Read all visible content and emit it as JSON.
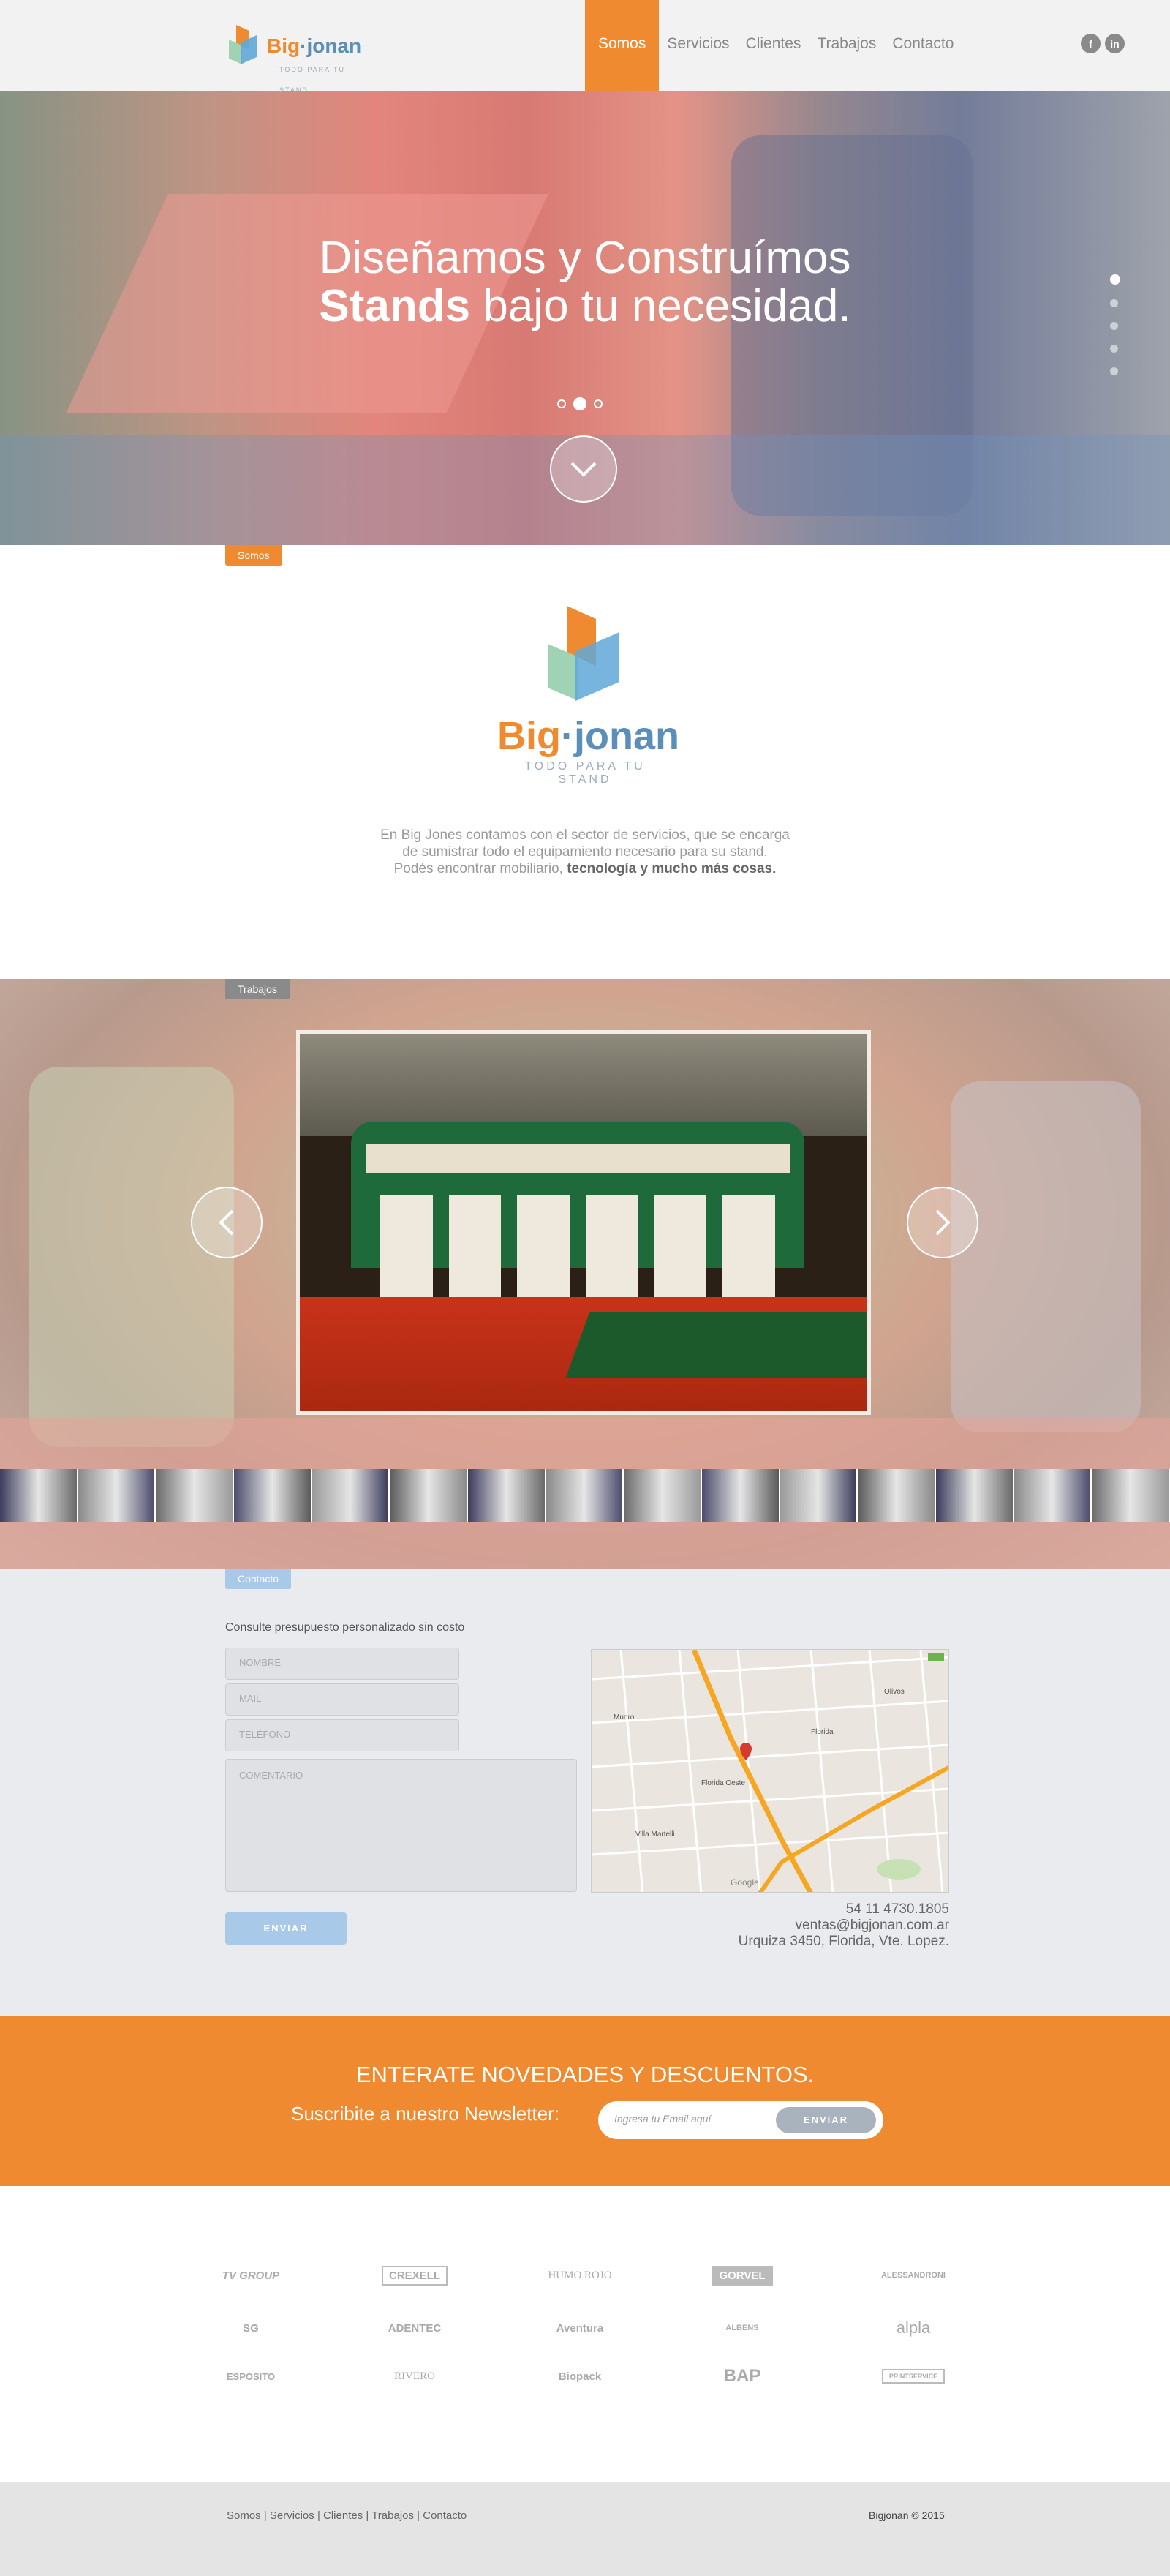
{
  "header": {
    "logo": {
      "brand_left": "Big",
      "brand_dot": "·",
      "brand_right": "jonan",
      "tagline": "TODO PARA TU STAND"
    },
    "nav": [
      "Somos",
      "Servicios",
      "Clientes",
      "Trabajos",
      "Contacto"
    ],
    "active_nav": "Somos",
    "social": [
      "facebook-icon",
      "linkedin-icon"
    ]
  },
  "hero": {
    "line1": "Diseñamos y Construímos",
    "line2_bold": "Stands",
    "line2_rest": " bajo tu necesidad.",
    "slide_dots": 3,
    "active_slide": 2,
    "section_dots": 5,
    "active_section": 1
  },
  "somos": {
    "tag": "Somos",
    "logo_brand_left": "Big",
    "logo_brand_dot": "·",
    "logo_brand_right": "jonan",
    "logo_tagline": "TODO PARA TU STAND",
    "text_line1": "En Big Jones contamos con el sector de servicios, que se encarga",
    "text_line2": "de sumistrar todo el equipamiento necesario para su stand.",
    "text_line3_plain": "Podés encontrar mobiliario, ",
    "text_line3_bold": "tecnología y mucho más cosas."
  },
  "trabajos": {
    "tag": "Trabajos",
    "thumb_count": 15
  },
  "contacto": {
    "tag": "Contacto",
    "title": "Consulte presupuesto personalizado sin costo",
    "fields": {
      "nombre": "NOMBRE",
      "mail": "MAIL",
      "telefono": "TELÉFONO",
      "comentario": "COMENTARIO"
    },
    "send_label": "ENVIAR",
    "phone": "54 11 4730.1805",
    "email": "ventas@bigjonan.com.ar",
    "address": "Urquiza 3450, Florida, Vte. Lopez.",
    "map_labels": [
      "Munro",
      "Florida",
      "Florida Oeste",
      "Villa Martelli",
      "Olivos",
      "Google"
    ]
  },
  "newsletter": {
    "title": "ENTERATE NOVEDADES Y DESCUENTOS.",
    "subtitle": "Suscribite a nuestro Newsletter:",
    "placeholder": "Ingresa tu Email aquí",
    "button": "ENVIAR"
  },
  "clients": [
    "TV GROUP",
    "CREXELL",
    "HUMO ROJO",
    "GORVEL",
    "ALESSANDRONI",
    "SG",
    "ADENTEC",
    "Aventura",
    "ALBENS",
    "alpla",
    "ESPOSITO",
    "RIVERO",
    "Biopack",
    "BAP",
    "PRINTSERVICE"
  ],
  "footer": {
    "links": [
      "Somos",
      "Servicios",
      "Clientes",
      "Trabajos",
      "Contacto"
    ],
    "copyright": "Bigjonan © 2015"
  },
  "colors": {
    "accent": "#f08a30",
    "blue": "#5b8fb9",
    "light_blue": "#a9c9e8",
    "gray_bg": "#e9ebee"
  }
}
